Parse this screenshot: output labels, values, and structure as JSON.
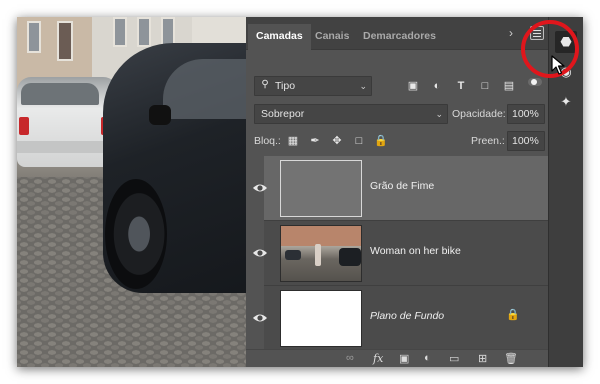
{
  "layers_panel": {
    "tabs": [
      {
        "label": "Camadas",
        "active": true
      },
      {
        "label": "Canais",
        "active": false
      },
      {
        "label": "Demarcadores",
        "active": false
      }
    ],
    "filter_select": "Tipo",
    "blend_mode": "Sobrepor",
    "opacity_label": "Opacidade:",
    "opacity_value": "100%",
    "lock_label": "Bloq.:",
    "fill_label": "Preen.:",
    "fill_value": "100%",
    "layers": [
      {
        "name": "Grão de Fime",
        "visible": true,
        "selected": true,
        "thumbnail": "gray-fill"
      },
      {
        "name": "Woman on her bike",
        "visible": true,
        "selected": false,
        "thumbnail": "street-photo"
      },
      {
        "name": "Plano de Fundo",
        "visible": true,
        "selected": false,
        "thumbnail": "white-fill",
        "locked": true
      }
    ]
  },
  "icons": {
    "panel_menu": "panel-menu-icon",
    "highlight_color": "#e0161c"
  },
  "colors": {
    "panel_bg": "#535353",
    "tabbar_bg": "#424242",
    "selected_layer": "#676767",
    "layer_row": "#4b4b4b"
  }
}
